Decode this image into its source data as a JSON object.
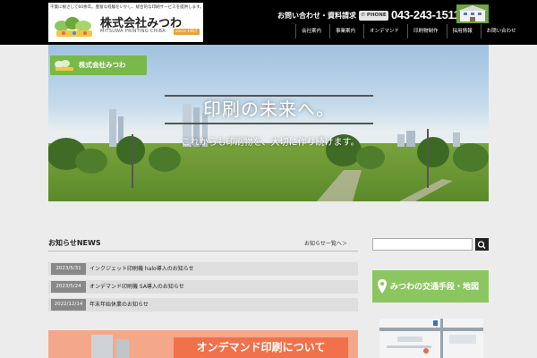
{
  "header": {
    "tagline": "千葉に根ざして60余年。豊富な経験をいかし、総合的な印刷サービスを提供します。",
    "company_name": "株式会社みつわ",
    "company_sub": "MITSUWA PRINTING CHIBA",
    "since": "since 1957",
    "contact_label": "お問い合わせ・資料請求",
    "phone_label": "PHONE",
    "phone_number": "043-243-1511"
  },
  "nav": {
    "items": [
      {
        "label": "会社案内"
      },
      {
        "label": "事業案内"
      },
      {
        "label": "オンデマンド"
      },
      {
        "label": "印刷物制作"
      },
      {
        "label": "採用情報"
      },
      {
        "label": "お問い合わせ"
      }
    ]
  },
  "hero": {
    "logo_text": "株式会社みつわ",
    "title": "印刷の未来へ。",
    "subtitle": "これからも印刷物を、大切に作り続けます。"
  },
  "news": {
    "title": "お知らせNEWS",
    "view_all": "お知らせ一覧へ＞",
    "items": [
      {
        "date": "2023/5/31",
        "text": "インクジェット印刷機 halo導入のお知らせ"
      },
      {
        "date": "2023/5/24",
        "text": "オンデマンド印刷機 SA導入のお知らせ"
      },
      {
        "date": "2022/12/14",
        "text": "年末年始休業のお知らせ"
      }
    ]
  },
  "banner": {
    "text": "オンデマンド印刷について"
  },
  "sidebar": {
    "search_placeholder": "",
    "access_label": "みつわの交通手段・地図"
  },
  "colors": {
    "header_bg": "#000000",
    "accent_green": "#8cc660",
    "banner_orange": "#f0714a"
  },
  "icons": [
    "phone-icon",
    "search-icon",
    "map-pin-icon"
  ]
}
